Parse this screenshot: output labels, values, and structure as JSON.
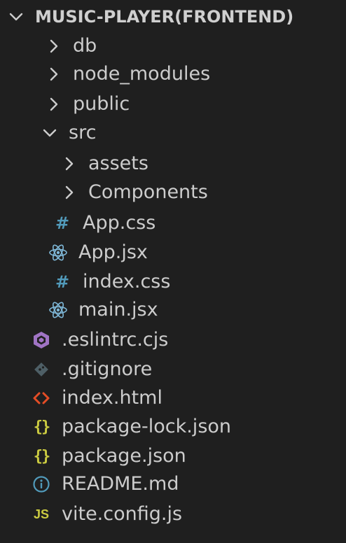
{
  "explorer": {
    "root": {
      "label": "MUSIC-PLAYER(FRONTEND)",
      "icon": "chevron-down-icon"
    },
    "items": [
      {
        "label": "db",
        "type": "folder",
        "state": "collapsed",
        "icon": "chevron-right-icon"
      },
      {
        "label": "node_modules",
        "type": "folder",
        "state": "collapsed",
        "icon": "chevron-right-icon"
      },
      {
        "label": "public",
        "type": "folder",
        "state": "collapsed",
        "icon": "chevron-right-icon"
      },
      {
        "label": "src",
        "type": "folder",
        "state": "expanded",
        "icon": "chevron-down-icon"
      },
      {
        "label": "assets",
        "type": "folder",
        "state": "collapsed",
        "icon": "chevron-right-icon"
      },
      {
        "label": "Components",
        "type": "folder",
        "state": "collapsed",
        "icon": "chevron-right-icon"
      },
      {
        "label": "App.css",
        "type": "file",
        "icon": "css-hash-icon",
        "icon_text": "#",
        "icon_color": "#519aba"
      },
      {
        "label": "App.jsx",
        "type": "file",
        "icon": "react-atom-icon",
        "icon_color": "#7fb8d8"
      },
      {
        "label": "index.css",
        "type": "file",
        "icon": "css-hash-icon",
        "icon_text": "#",
        "icon_color": "#519aba"
      },
      {
        "label": "main.jsx",
        "type": "file",
        "icon": "react-atom-icon",
        "icon_color": "#7fb8d8"
      },
      {
        "label": ".eslintrc.cjs",
        "type": "file",
        "icon": "eslint-hexagon-icon",
        "icon_color": "#a074c4"
      },
      {
        "label": ".gitignore",
        "type": "file",
        "icon": "git-diamond-icon",
        "icon_color": "#41535b"
      },
      {
        "label": "index.html",
        "type": "file",
        "icon": "html-brackets-icon",
        "icon_text": "<>",
        "icon_color": "#e44d26"
      },
      {
        "label": "package-lock.json",
        "type": "file",
        "icon": "json-braces-icon",
        "icon_text": "{}",
        "icon_color": "#cbcb41"
      },
      {
        "label": "package.json",
        "type": "file",
        "icon": "json-braces-icon",
        "icon_text": "{}",
        "icon_color": "#cbcb41"
      },
      {
        "label": "README.md",
        "type": "file",
        "icon": "info-icon",
        "icon_color": "#519aba"
      },
      {
        "label": "vite.config.js",
        "type": "file",
        "icon": "javascript-icon",
        "icon_text": "JS",
        "icon_color": "#cbcb41"
      }
    ]
  }
}
